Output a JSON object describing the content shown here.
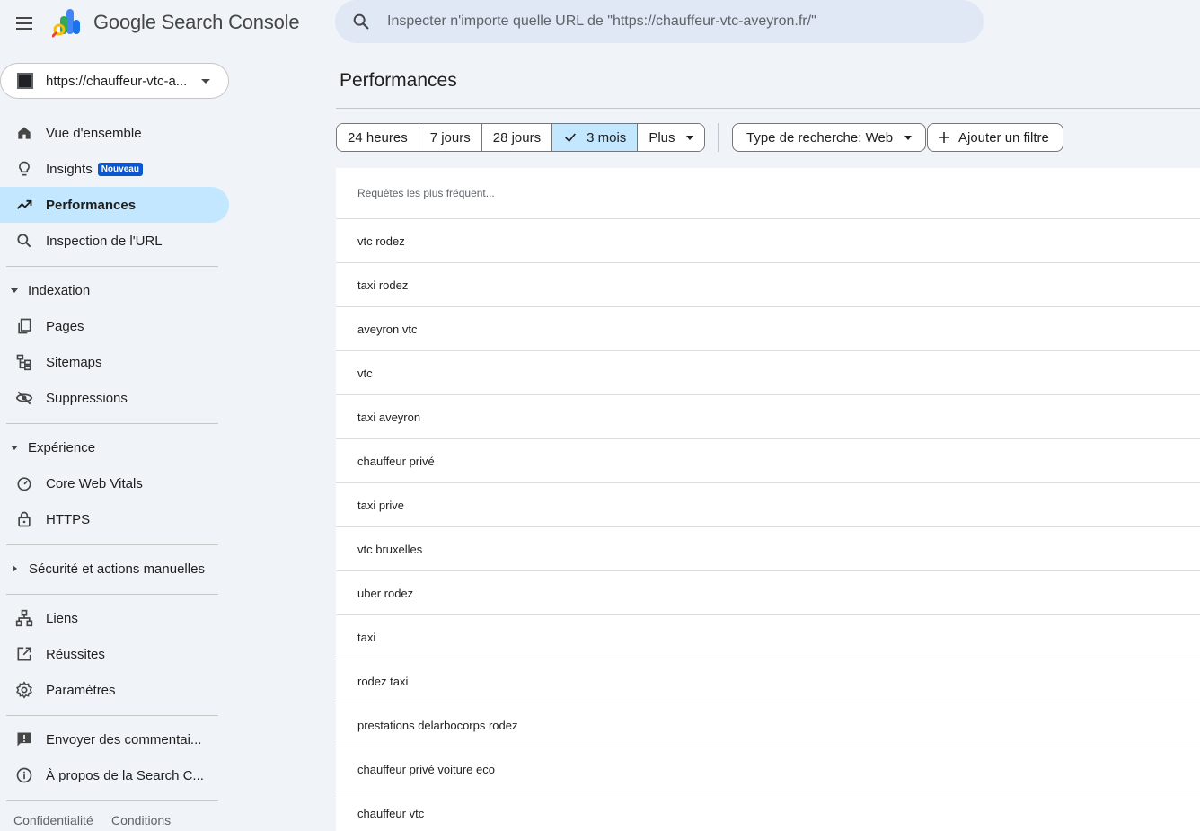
{
  "header": {
    "logo_text": "Google Search Console",
    "search_placeholder": "Inspecter n'importe quelle URL de \"https://chauffeur-vtc-aveyron.fr/\""
  },
  "property": {
    "label": "https://chauffeur-vtc-a..."
  },
  "sidebar": {
    "overview": "Vue d'ensemble",
    "insights": "Insights",
    "insights_badge": "Nouveau",
    "performance": "Performances",
    "url_inspection": "Inspection de l'URL",
    "indexing_section": "Indexation",
    "pages": "Pages",
    "sitemaps": "Sitemaps",
    "removals": "Suppressions",
    "experience_section": "Expérience",
    "core_web_vitals": "Core Web Vitals",
    "https": "HTTPS",
    "security_section": "Sécurité et actions manuelles",
    "links": "Liens",
    "achievements": "Réussites",
    "settings": "Paramètres",
    "feedback": "Envoyer des commentai...",
    "about": "À propos de la Search C...",
    "privacy": "Confidentialité",
    "terms": "Conditions"
  },
  "main": {
    "title": "Performances",
    "ranges": [
      "24 heures",
      "7 jours",
      "28 jours",
      "3 mois",
      "Plus"
    ],
    "selected_range": "3 mois",
    "search_type_filter": "Type de recherche: Web",
    "add_filter": "Ajouter un filtre",
    "table_header": "Requêtes les plus fréquent...",
    "queries": [
      "vtc rodez",
      "taxi rodez",
      "aveyron vtc",
      "vtc",
      "taxi aveyron",
      "chauffeur privé",
      "taxi prive",
      "vtc bruxelles",
      "uber rodez",
      "taxi",
      "rodez taxi",
      "prestations delarbocorps rodez",
      "chauffeur privé voiture eco",
      "chauffeur vtc"
    ]
  },
  "colors": {
    "accent_selected": "#c2e7ff",
    "badge_blue": "#0b57d0",
    "background": "#f0f4f9"
  }
}
